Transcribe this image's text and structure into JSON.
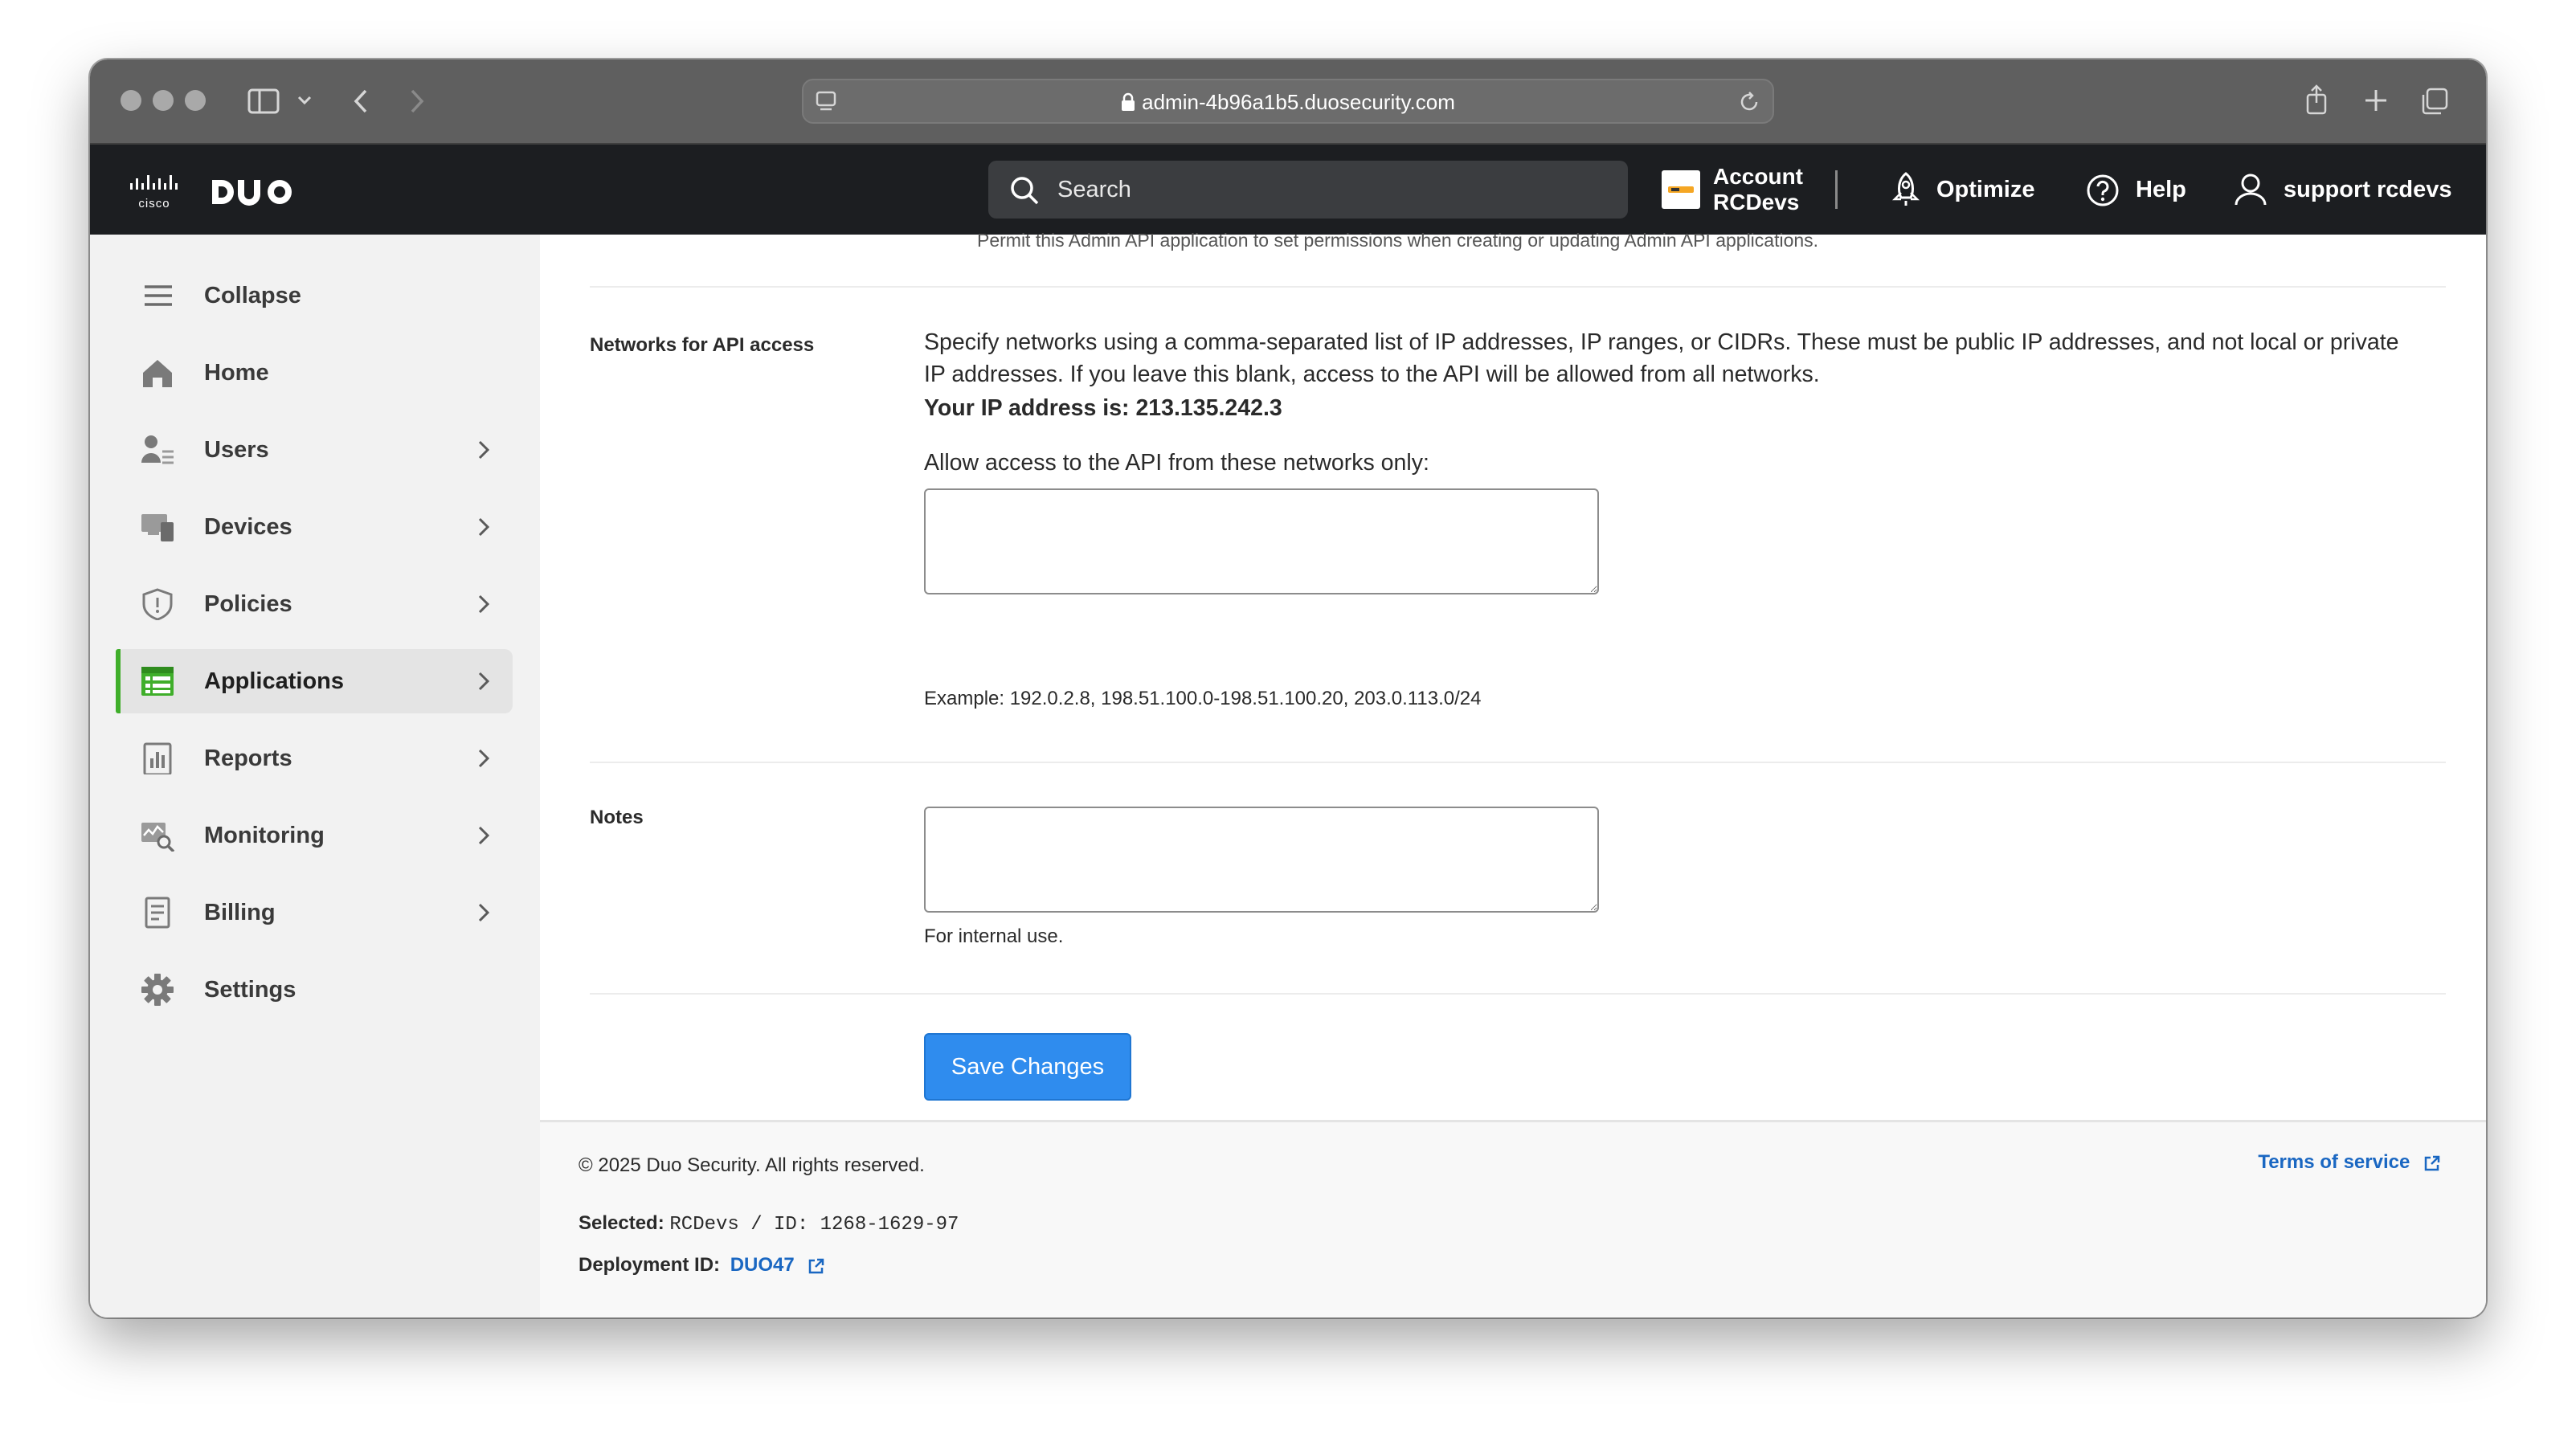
{
  "browser": {
    "url": "admin-4b96a1b5.duosecurity.com"
  },
  "header": {
    "brand_cisco": "cisco",
    "search_placeholder": "Search",
    "account_line1": "Account",
    "account_line2": "RCDevs",
    "optimize": "Optimize",
    "help": "Help",
    "user": "support rcdevs"
  },
  "sidebar": {
    "items": [
      {
        "label": "Collapse",
        "icon": "menu-icon"
      },
      {
        "label": "Home",
        "icon": "home-icon"
      },
      {
        "label": "Users",
        "icon": "users-icon"
      },
      {
        "label": "Devices",
        "icon": "devices-icon"
      },
      {
        "label": "Policies",
        "icon": "shield-icon"
      },
      {
        "label": "Applications",
        "icon": "applications-icon"
      },
      {
        "label": "Reports",
        "icon": "reports-icon"
      },
      {
        "label": "Monitoring",
        "icon": "monitoring-icon"
      },
      {
        "label": "Billing",
        "icon": "billing-icon"
      },
      {
        "label": "Settings",
        "icon": "gear-icon"
      }
    ],
    "active": "Applications",
    "accent": "#3fae2a"
  },
  "form": {
    "cut_off_text": "Permit this Admin API application to set permissions when creating or updating Admin API applications.",
    "networks_label": "Networks for API access",
    "networks_description": "Specify networks using a comma-separated list of IP addresses, IP ranges, or CIDRs. These must be public IP addresses, and not local or private IP addresses. If you leave this blank, access to the API will be allowed from all networks.",
    "ip_address_line": "Your IP address is: 213.135.242.3",
    "allow_label": "Allow access to the API from these networks only:",
    "networks_value": "",
    "networks_example": "Example: 192.0.2.8, 198.51.100.0-198.51.100.20, 203.0.113.0/24",
    "notes_label": "Notes",
    "notes_value": "",
    "notes_hint": "For internal use.",
    "save_button": "Save Changes",
    "button_color": "#2f8cee"
  },
  "footer": {
    "copyright": "© 2025 Duo Security. All rights reserved.",
    "terms": "Terms of service",
    "selected_label": "Selected:",
    "selected_value": "RCDevs / ID: 1268-1629-97",
    "deployment_label": "Deployment ID:",
    "deployment_value": "DUO47",
    "link_color": "#1a67c2"
  }
}
